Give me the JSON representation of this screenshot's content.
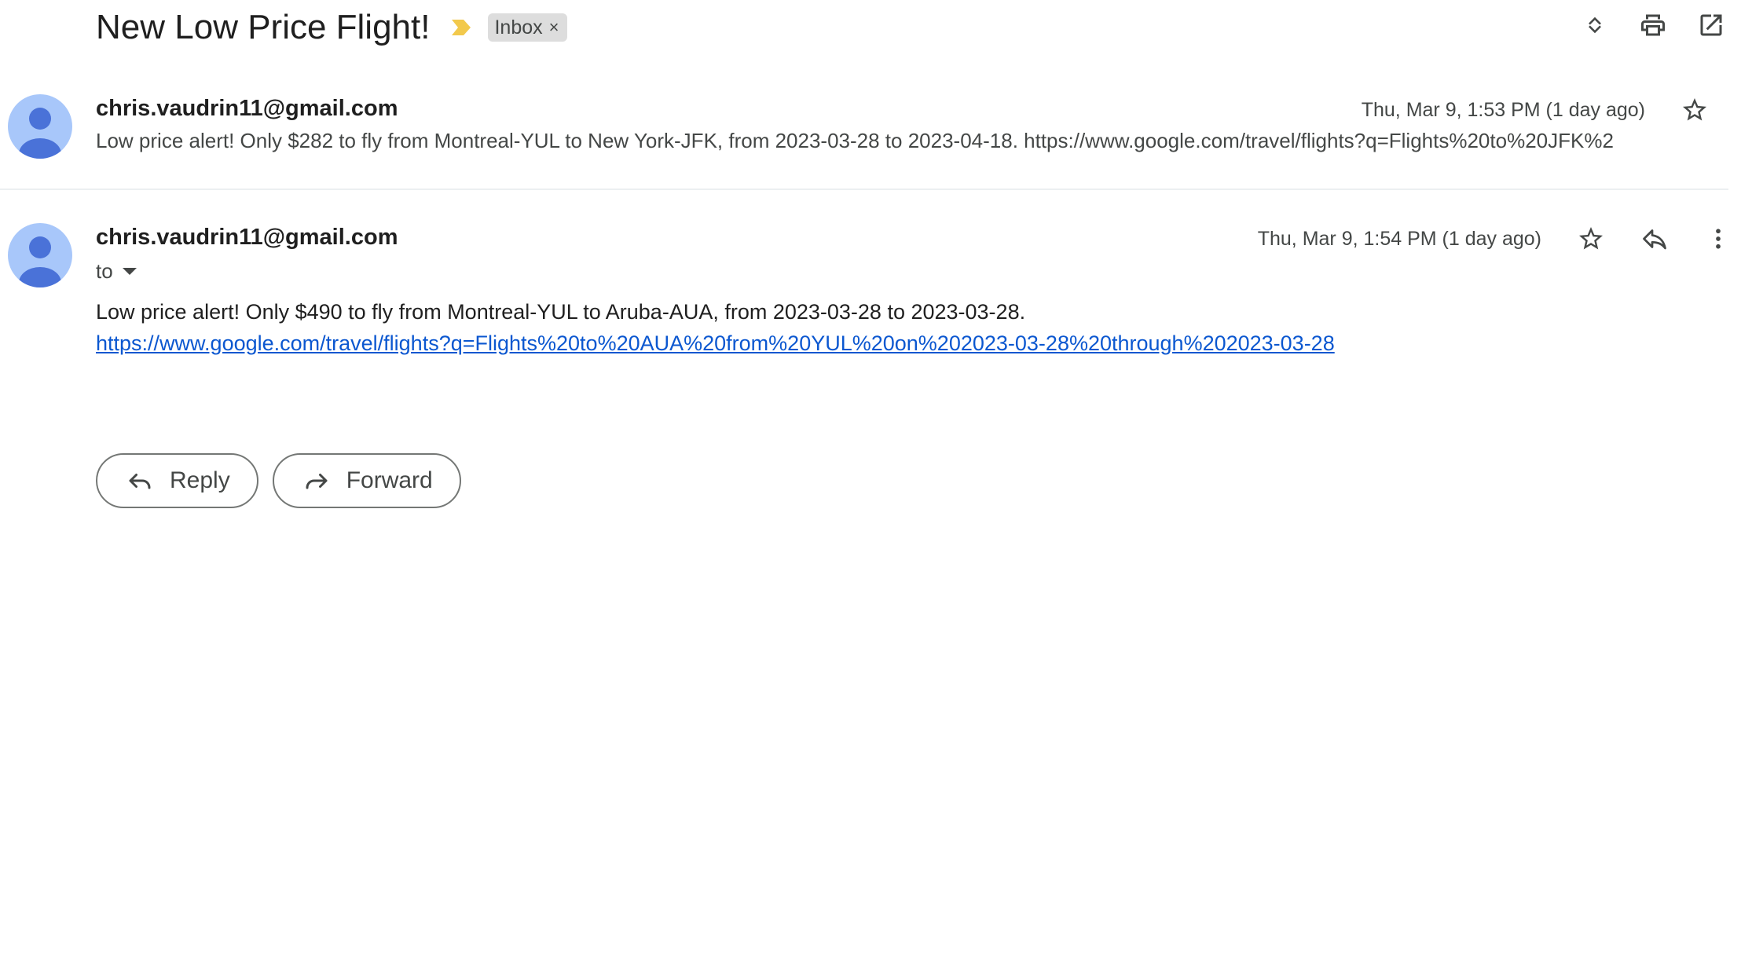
{
  "thread": {
    "subject": "New Low Price Flight!",
    "label": "Inbox",
    "label_remove": "×",
    "accent_color": "#f2c94c"
  },
  "header_actions": {
    "icons": [
      "expand-collapse-icon",
      "print-icon",
      "open-in-new-window-icon"
    ]
  },
  "messages": [
    {
      "sender": "chris.vaudrin11@gmail.com",
      "date": "Thu, Mar 9, 1:53 PM (1 day ago)",
      "snippet": "Low price alert! Only $282 to fly from Montreal-YUL to New York-JFK, from 2023-03-28 to 2023-04-18. https://www.google.com/travel/flights?q=Flights%20to%20JFK%2"
    },
    {
      "sender": "chris.vaudrin11@gmail.com",
      "date": "Thu, Mar 9, 1:54 PM (1 day ago)",
      "to_label": "to",
      "body": "Low price alert! Only $490 to fly from Montreal-YUL to Aruba-AUA, from 2023-03-28 to 2023-03-28.",
      "link": "https://www.google.com/travel/flights?q=Flights%20to%20AUA%20from%20YUL%20on%202023-03-28%20through%202023-03-28"
    }
  ],
  "actions": {
    "reply_label": "Reply",
    "forward_label": "Forward"
  }
}
